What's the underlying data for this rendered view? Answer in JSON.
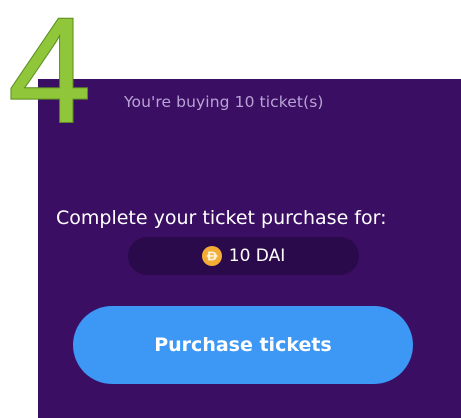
{
  "step": {
    "number": "4",
    "color": "#8fc63a"
  },
  "purchase": {
    "subtitle": "You're buying 10 ticket(s)",
    "complete_label": "Complete your ticket purchase for:",
    "amount": "10 DAI",
    "token_icon": "dai-coin-icon",
    "button_label": "Purchase tickets"
  },
  "colors": {
    "panel_background": "#3a0f63",
    "pill_background": "#2a0a4a",
    "button_background": "#3c97f5",
    "coin": "#f5ac37"
  }
}
